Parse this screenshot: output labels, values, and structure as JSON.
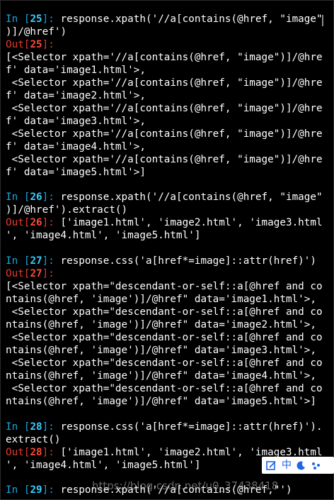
{
  "terminal": {
    "cells": [
      {
        "in_label": "In [",
        "in_num": "25",
        "in_close": "]:",
        "code": [
          " response.xpath('//a[contains(@href, \"image\"",
          ")]/@href')"
        ],
        "out_label": "Out[",
        "out_num": "25",
        "out_close": "]:",
        "output": [
          "[<Selector xpath='//a[contains(@href, \"image\")]/@hre",
          "f' data='image1.html'>,",
          " <Selector xpath='//a[contains(@href, \"image\")]/@hre",
          "f' data='image2.html'>,",
          " <Selector xpath='//a[contains(@href, \"image\")]/@hre",
          "f' data='image3.html'>,",
          " <Selector xpath='//a[contains(@href, \"image\")]/@hre",
          "f' data='image4.html'>,",
          " <Selector xpath='//a[contains(@href, \"image\")]/@hre",
          "f' data='image5.html'>]"
        ]
      },
      {
        "in_label": "In [",
        "in_num": "26",
        "in_close": "]:",
        "code": [
          " response.xpath('//a[contains(@href, \"image\"",
          ")]/@href').extract()"
        ],
        "out_label": "Out[",
        "out_num": "26",
        "out_close": "]:",
        "output": [
          " ['image1.html', 'image2.html', 'image3.html",
          "', 'image4.html', 'image5.html']"
        ]
      },
      {
        "in_label": "In [",
        "in_num": "27",
        "in_close": "]:",
        "code": [
          " response.css('a[href*=image]::attr(href)')"
        ],
        "out_label": "Out[",
        "out_num": "27",
        "out_close": "]:",
        "output": [
          "[<Selector xpath=\"descendant-or-self::a[@href and co",
          "ntains(@href, 'image')]/@href\" data='image1.html'>,",
          " <Selector xpath=\"descendant-or-self::a[@href and co",
          "ntains(@href, 'image')]/@href\" data='image2.html'>,",
          " <Selector xpath=\"descendant-or-self::a[@href and co",
          "ntains(@href, 'image')]/@href\" data='image3.html'>,",
          " <Selector xpath=\"descendant-or-self::a[@href and co",
          "ntains(@href, 'image')]/@href\" data='image4.html'>,",
          " <Selector xpath=\"descendant-or-self::a[@href and co",
          "ntains(@href, 'image')]/@href\" data='image5.html'>]"
        ]
      },
      {
        "in_label": "In [",
        "in_num": "28",
        "in_close": "]:",
        "code": [
          " response.css('a[href*=image]::attr(href)').",
          "extract()"
        ],
        "out_label": "Out[",
        "out_num": "28",
        "out_close": "]:",
        "output": [
          " ['image1.html', 'image2.html', 'image3.html",
          "', 'image4.html', 'image5.html']"
        ]
      },
      {
        "in_label": "In [",
        "in_num": "29",
        "in_close": "]:",
        "code": [
          " response.xpath('//a[contains(@href,\"')"
        ],
        "out_label": "",
        "out_num": "",
        "out_close": "",
        "output": []
      }
    ]
  },
  "ime_toolbar": {
    "language": "中",
    "icons": [
      "edit-icon",
      "moon-icon",
      "dots-icon"
    ]
  },
  "watermark": "https://blog.csdn.net/u0_37438418",
  "colors": {
    "background": "#000000",
    "prompt_in": "#1aa3d8",
    "prompt_out": "#e23b2e",
    "text": "#ffffff"
  }
}
